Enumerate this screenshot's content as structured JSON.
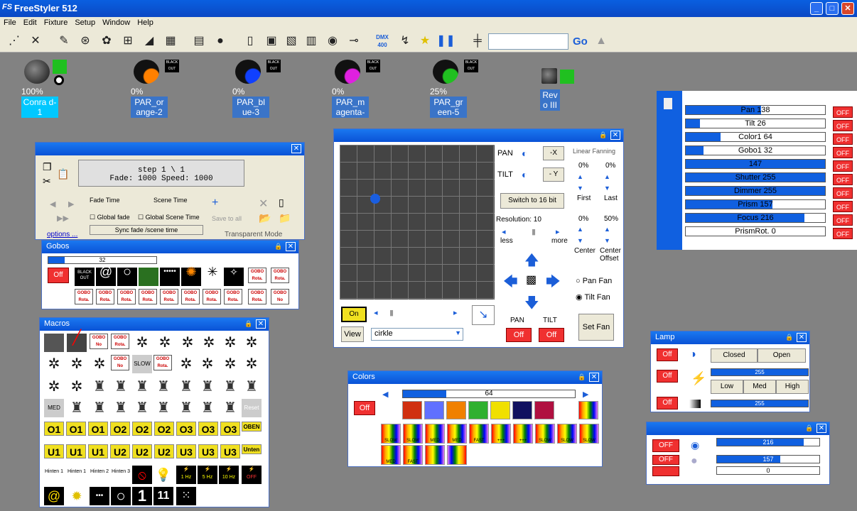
{
  "app": {
    "title": "FreeStyler 512",
    "icon": "FS"
  },
  "menu": [
    "File",
    "Edit",
    "Fixture",
    "Setup",
    "Window",
    "Help"
  ],
  "toolbar": {
    "go_label": "Go",
    "dmx_label": "DMX 400"
  },
  "fixtures": [
    {
      "pct": "100%",
      "name": "Conra d-1",
      "color": "#00c8ff"
    },
    {
      "pct": "0%",
      "name": "PAR_or ange-2",
      "color": "#ff8000"
    },
    {
      "pct": "0%",
      "name": "PAR_bl ue-3",
      "color": "#1040ff"
    },
    {
      "pct": "0%",
      "name": "PAR_m agenta-",
      "color": "#e020e0"
    },
    {
      "pct": "25%",
      "name": "PAR_gr een-5",
      "color": "#20c020"
    },
    {
      "pct": "",
      "name": "Rev o III",
      "color": "#20c020"
    }
  ],
  "cut_label": "BLACK OUT",
  "sequencer": {
    "step": "step 1 \\ 1",
    "fade": "Fade: 1000 Speed: 1000",
    "fade_time": "Fade Time",
    "scene_time": "Scene Time",
    "global_fade": "Global fade",
    "global_scene": "Global Scene Time",
    "sync": "Sync fade /scene time",
    "save_all": "Save to all",
    "transparent": "Transparent Mode",
    "options": "options ..."
  },
  "gobos": {
    "title": "Gobos",
    "value": "32",
    "value_pct": 0.15,
    "off": "Off",
    "black_out": "BLACK OUT",
    "gobo_rota": "GOBO Rota.",
    "gobo_no": "GOBO No"
  },
  "macros": {
    "title": "Macros",
    "gobo_no": "GOBO No",
    "gobo_rota": "GOBO Rota.",
    "slow": "SLOW",
    "med": "MED",
    "reset": "Reset",
    "o_row": [
      "O1",
      "O1",
      "O1",
      "O2",
      "O2",
      "O2",
      "O3",
      "O3",
      "O3"
    ],
    "oben": "OBEN",
    "u_row": [
      "U1",
      "U1",
      "U1",
      "U2",
      "U2",
      "U2",
      "U3",
      "U3",
      "U3"
    ],
    "unten": "Unten",
    "bottom_row": [
      "Hinten 1",
      "Hinten 1",
      "Hinten 2",
      "Hinten 3",
      "",
      "",
      "1 Hz",
      "5 Hz",
      "10 Hz",
      "OFF"
    ],
    "last_row": [
      "",
      "",
      "",
      "",
      "1",
      "11",
      ""
    ]
  },
  "pantilt": {
    "pan": "PAN",
    "tilt": "TILT",
    "minus_x": "-X",
    "minus_y": "- Y",
    "switch": "Switch to 16 bit",
    "resolution": "Resolution: 10",
    "less": "less",
    "more": "more",
    "linear": "Linear Fanning",
    "p1": "0%",
    "p2": "0%",
    "first": "First",
    "last": "Last",
    "p3": "0%",
    "p4": "50%",
    "center": "Center",
    "center_offset": "Center Offset",
    "pan_fan": "Pan Fan",
    "tilt_fan": "Tilt Fan",
    "set_fan": "Set Fan",
    "on": "On",
    "view": "View",
    "cirkle": "cirkle",
    "pan_lbl": "PAN",
    "tilt_lbl": "TILT",
    "off": "Off",
    "dot_x": 0.23,
    "dot_y": 0.35
  },
  "channels": [
    {
      "name": "Pan",
      "value": "138",
      "pct": 0.54
    },
    {
      "name": "Tilt",
      "value": "26",
      "pct": 0.1
    },
    {
      "name": "Color1",
      "value": "64",
      "pct": 0.25
    },
    {
      "name": "Gobo1",
      "value": "32",
      "pct": 0.13
    },
    {
      "name": "",
      "value": "147",
      "pct": 1.0
    },
    {
      "name": "Shutter",
      "value": "255",
      "pct": 1.0
    },
    {
      "name": "Dimmer",
      "value": "255",
      "pct": 1.0
    },
    {
      "name": "Prism",
      "value": "157",
      "pct": 0.62
    },
    {
      "name": "Focus",
      "value": "216",
      "pct": 0.85
    },
    {
      "name": "PrismRot.",
      "value": "0",
      "pct": 0.0
    }
  ],
  "channel_off": "OFF",
  "lamp": {
    "title": "Lamp",
    "off": "Off",
    "closed": "Closed",
    "open": "Open",
    "low": "Low",
    "med": "Med",
    "high": "High",
    "v1": "255",
    "v2": "255"
  },
  "colors": {
    "title": "Colors",
    "value": "64",
    "value_pct": 0.25,
    "off": "Off",
    "swatches": [
      "#d03010",
      "#6070ff",
      "#f08000",
      "#30b030",
      "#f0e000",
      "#101060",
      "#b01040"
    ],
    "slow": "SLOW",
    "med": "MED",
    "fast": "FAST",
    "plus": "+++"
  },
  "speed": {
    "off": "OFF",
    "v1": "216",
    "p1": 0.85,
    "v2": "157",
    "p2": 0.62,
    "v3": "0",
    "p3": 0.0
  }
}
